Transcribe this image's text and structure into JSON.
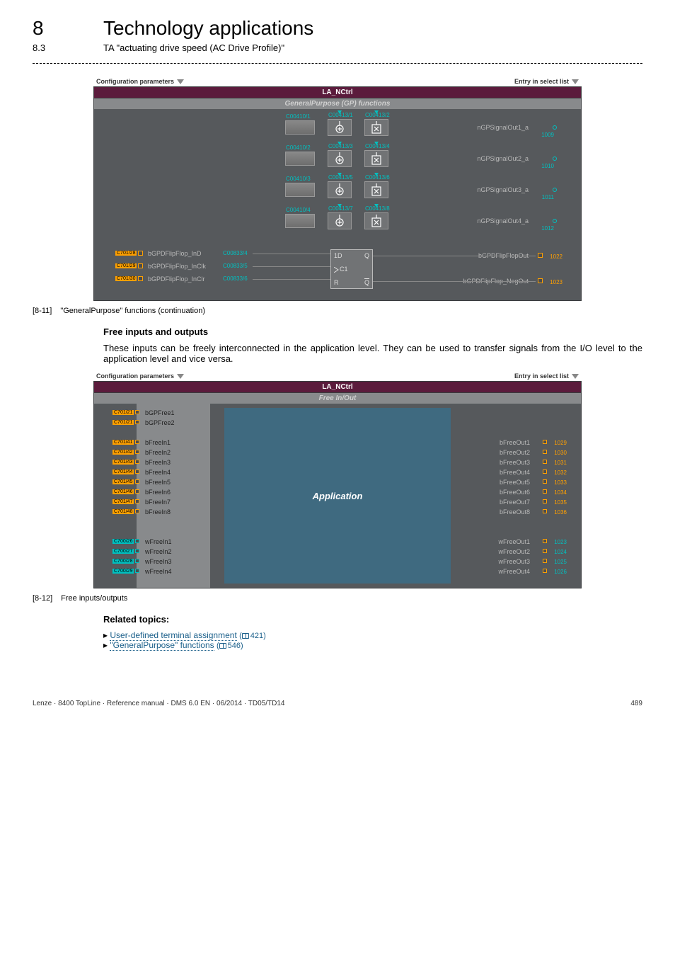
{
  "chapter": {
    "num": "8",
    "title": "Technology applications"
  },
  "section": {
    "num": "8.3",
    "title": "TA \"actuating drive speed (AC Drive Profile)\""
  },
  "dia_head_left": "Configuration parameters",
  "dia_head_right": "Entry in select list",
  "d1": {
    "title": "LA_NCtrl",
    "subtitle": "GeneralPurpose (GP) functions",
    "stages": [
      {
        "filter": "C00410/1",
        "op1": "C00413/1",
        "op2": "C00413/2",
        "out": "nGPSignalOut1_a",
        "idx": "1009"
      },
      {
        "filter": "C00410/2",
        "op1": "C00413/3",
        "op2": "C00413/4",
        "out": "nGPSignalOut2_a",
        "idx": "1010"
      },
      {
        "filter": "C00410/3",
        "op1": "C00413/5",
        "op2": "C00413/6",
        "out": "nGPSignalOut3_a",
        "idx": "1011"
      },
      {
        "filter": "C00410/4",
        "op1": "C00413/7",
        "op2": "C00413/8",
        "out": "nGPSignalOut4_a",
        "idx": "1012"
      }
    ],
    "ff_in": [
      {
        "port": "C701/28",
        "label": "bGPDFlipFlop_InD",
        "param": "C00833/4"
      },
      {
        "port": "C701/29",
        "label": "bGPDFlipFlop_InClk",
        "param": "C00833/5"
      },
      {
        "port": "C701/30",
        "label": "bGPDFlipFlop_InClr",
        "param": "C00833/6"
      }
    ],
    "ff_pins": {
      "tl": "1D",
      "tr": "Q",
      "ml": "C1",
      "bl": "R",
      "br": "Q"
    },
    "ff_out": [
      {
        "label": "bGPDFlipFlopOut",
        "idx": "1022"
      },
      {
        "label": "bGPDFlipFlop_NegOut",
        "idx": "1023"
      }
    ]
  },
  "caption1_idx": "[8-11]",
  "caption1_txt": "\"GeneralPurpose\" functions (continuation)",
  "subhead1": "Free inputs and outputs",
  "para1": "These inputs can be freely interconnected in the application level. They can be used to transfer signals from the I/O level to the application level and vice versa.",
  "d2": {
    "title": "LA_NCtrl",
    "subtitle": "Free In/Out",
    "app_label": "Application",
    "gp_in": [
      {
        "port": "C701/21",
        "label": "bGPFree1"
      },
      {
        "port": "C701/21",
        "label": "bGPFree2"
      }
    ],
    "b_in": [
      {
        "port": "C701/41",
        "label": "bFreeIn1"
      },
      {
        "port": "C701/42",
        "label": "bFreeIn2"
      },
      {
        "port": "C701/43",
        "label": "bFreeIn3"
      },
      {
        "port": "C701/44",
        "label": "bFreeIn4"
      },
      {
        "port": "C701/45",
        "label": "bFreeIn5"
      },
      {
        "port": "C701/46",
        "label": "bFreeIn6"
      },
      {
        "port": "C701/47",
        "label": "bFreeIn7"
      },
      {
        "port": "C701/48",
        "label": "bFreeIn8"
      }
    ],
    "w_in": [
      {
        "port": "C700/26",
        "label": "wFreeIn1"
      },
      {
        "port": "C700/27",
        "label": "wFreeIn2"
      },
      {
        "port": "C700/28",
        "label": "wFreeIn3"
      },
      {
        "port": "C700/29",
        "label": "wFreeIn4"
      }
    ],
    "b_out": [
      {
        "label": "bFreeOut1",
        "idx": "1029"
      },
      {
        "label": "bFreeOut2",
        "idx": "1030"
      },
      {
        "label": "bFreeOut3",
        "idx": "1031"
      },
      {
        "label": "bFreeOut4",
        "idx": "1032"
      },
      {
        "label": "bFreeOut5",
        "idx": "1033"
      },
      {
        "label": "bFreeOut6",
        "idx": "1034"
      },
      {
        "label": "bFreeOut7",
        "idx": "1035"
      },
      {
        "label": "bFreeOut8",
        "idx": "1036"
      }
    ],
    "w_out": [
      {
        "label": "wFreeOut1",
        "idx": "1023"
      },
      {
        "label": "wFreeOut2",
        "idx": "1024"
      },
      {
        "label": "wFreeOut3",
        "idx": "1025"
      },
      {
        "label": "wFreeOut4",
        "idx": "1026"
      }
    ]
  },
  "caption2_idx": "[8-12]",
  "caption2_txt": "Free inputs/outputs",
  "related_head": "Related topics:",
  "link1_txt": "User-defined terminal assignment",
  "link1_pg": "421",
  "link2_txt": "\"GeneralPurpose\" functions",
  "link2_pg": "546",
  "footer_left": "Lenze · 8400 TopLine · Reference manual · DMS 6.0 EN · 06/2014 · TD05/TD14",
  "footer_right": "489"
}
